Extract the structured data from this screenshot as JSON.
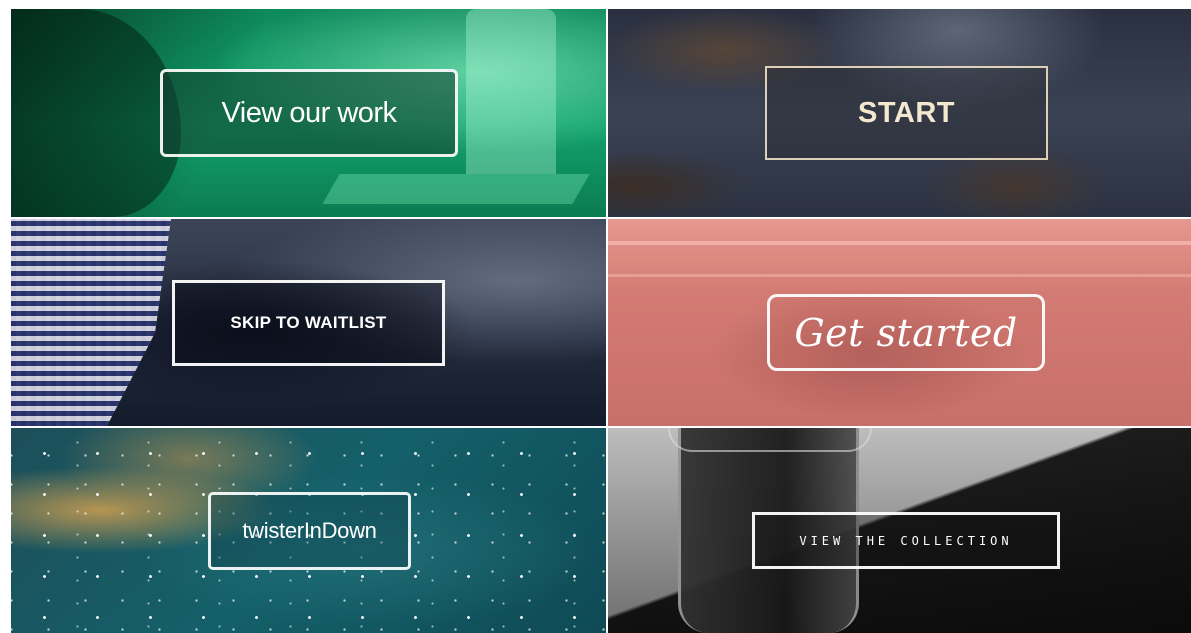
{
  "tiles": [
    {
      "button_label": "View our work"
    },
    {
      "button_label": "START"
    },
    {
      "button_label": "SKIP TO WAITLIST"
    },
    {
      "button_label": "Get started"
    },
    {
      "button_label": "twisterInDown"
    },
    {
      "button_label": "VIEW THE COLLECTION"
    }
  ]
}
